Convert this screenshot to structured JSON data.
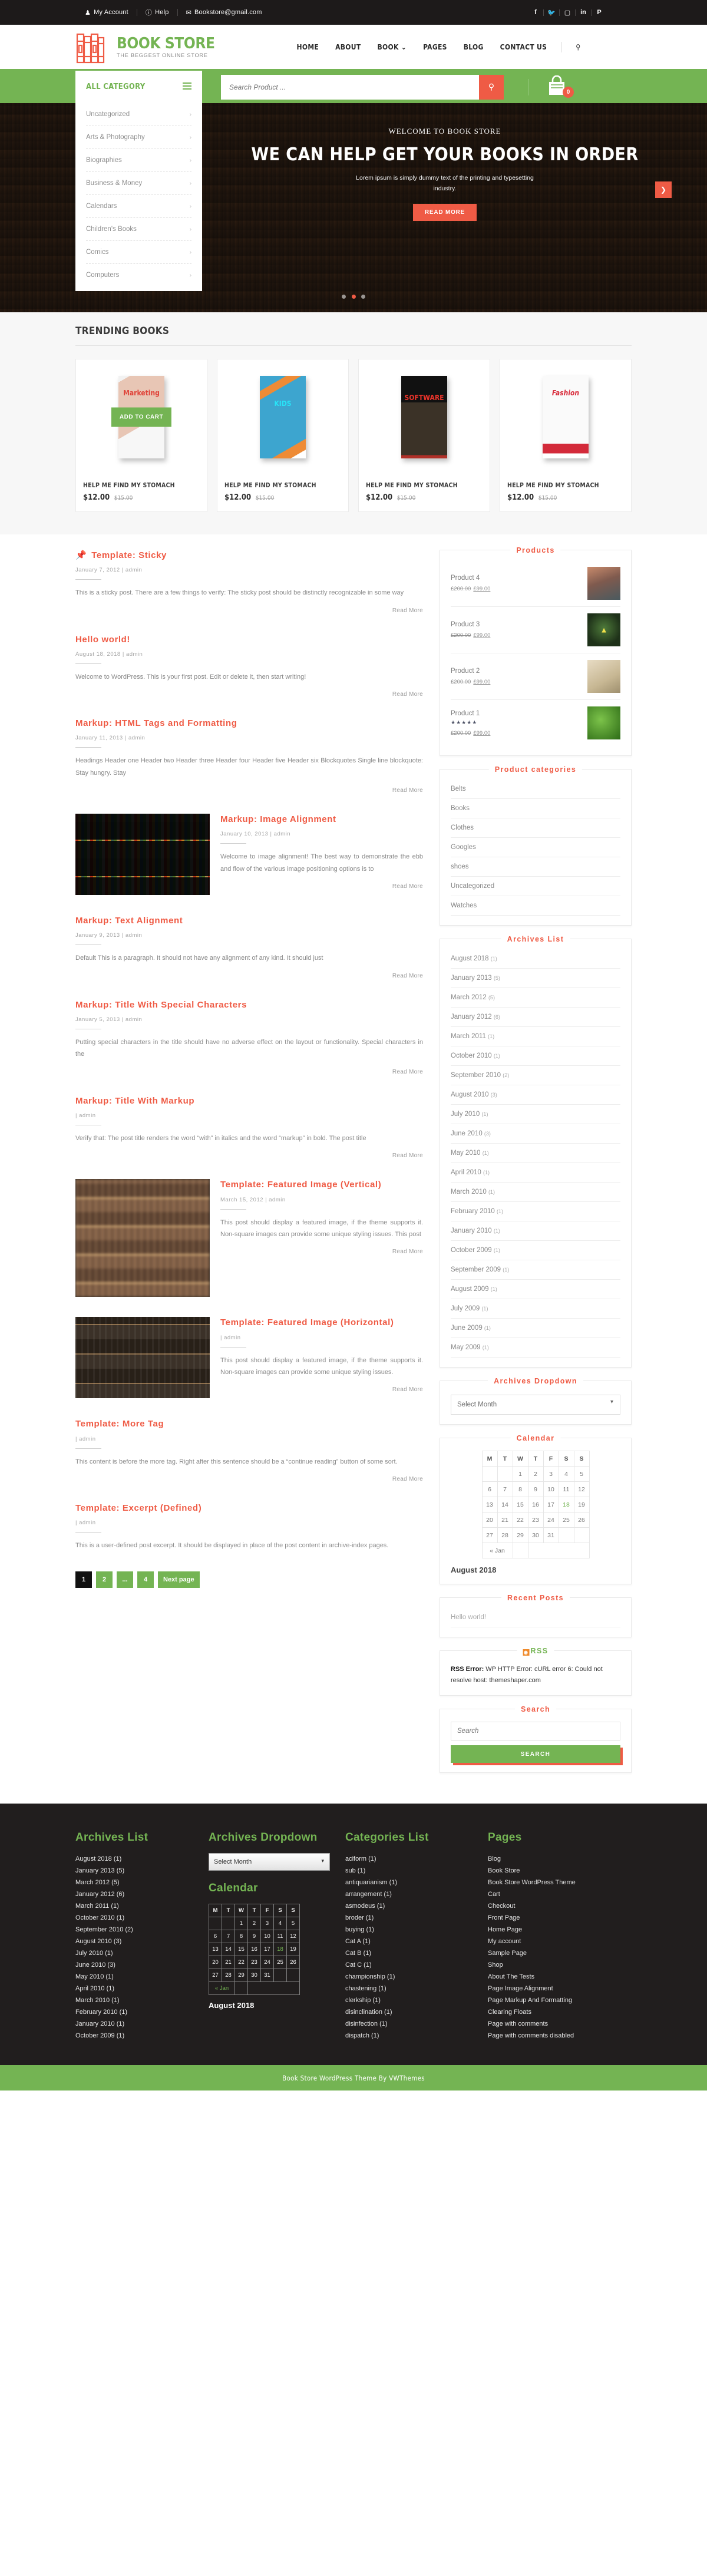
{
  "topbar": {
    "links": [
      {
        "icon": "user-icon",
        "label": "My Account"
      },
      {
        "icon": "help-icon",
        "label": "Help"
      },
      {
        "icon": "mail-icon",
        "label": "Bookstore@gmail.com"
      }
    ],
    "social": [
      "facebook-icon",
      "twitter-icon",
      "instagram-icon",
      "linkedin-icon",
      "pinterest-icon"
    ]
  },
  "header": {
    "logo_title": "BOOK STORE",
    "logo_sub": "THE BEGGEST ONLINE STORE",
    "nav": [
      {
        "label": "HOME"
      },
      {
        "label": "ABOUT"
      },
      {
        "label": "BOOK",
        "caret": "⌄"
      },
      {
        "label": "PAGES"
      },
      {
        "label": "BLOG"
      },
      {
        "label": "CONTACT US"
      }
    ]
  },
  "searchband": {
    "category_label": "ALL CATEGORY",
    "placeholder": "Search Product ...",
    "cart_count": "0"
  },
  "categories": [
    "Uncategorized",
    "Arts & Photography",
    "Biographies",
    "Business & Money",
    "Calendars",
    "Children's Books",
    "Comics",
    "Computers"
  ],
  "hero": {
    "eyebrow": "WELCOME TO BOOK STORE",
    "title": "WE CAN HELP GET YOUR BOOKS IN  ORDER",
    "desc": "Lorem ipsum is simply dummy text of the printing and typesetting industry.",
    "button": "READ MORE",
    "arrow": "❯"
  },
  "trending": {
    "title": "TRENDING BOOKS",
    "add_to_cart": "ADD TO CART",
    "items": [
      {
        "cover": "Marketing",
        "name": "HELP ME FIND MY  STOMACH",
        "price": "$12.00",
        "was": "$15.00"
      },
      {
        "cover": "KIDS",
        "name": "HELP ME FIND MY  STOMACH",
        "price": "$12.00",
        "was": "$15.00"
      },
      {
        "cover": "SOFTWARE",
        "name": "HELP ME FIND MY  STOMACH",
        "price": "$12.00",
        "was": "$15.00"
      },
      {
        "cover": "Fashion",
        "name": "HELP ME FIND MY  STOMACH",
        "price": "$12.00",
        "was": "$15.00"
      }
    ]
  },
  "read_more": "Read More",
  "posts": [
    {
      "title": "Template: Sticky",
      "sticky": true,
      "meta": "January 7, 2012 |  admin",
      "text": "This is a sticky post. There are a few things to verify: The sticky post should be distinctly recognizable in some way",
      "layout": "plain"
    },
    {
      "title": "Hello world!",
      "meta": "August 18, 2018 |  admin",
      "text": "Welcome to WordPress. This is your first post. Edit or delete it, then start writing!",
      "layout": "plain"
    },
    {
      "title": "Markup: HTML Tags and Formatting",
      "meta": "January 11, 2013 |  admin",
      "text": "Headings Header one Header two Header three Header four Header five Header six Blockquotes Single line blockquote: Stay hungry. Stay",
      "layout": "plain"
    },
    {
      "title": "Markup: Image Alignment",
      "meta": "January 10, 2013 |  admin",
      "text": "Welcome to image alignment! The best way to demonstrate the ebb and flow of the various image positioning options is to",
      "layout": "image-left",
      "thumb": "colorful"
    },
    {
      "title": "Markup: Text Alignment",
      "meta": "January 9, 2013 |  admin",
      "text": "Default This is a paragraph. It should not have any alignment of any kind. It should just",
      "layout": "plain"
    },
    {
      "title": "Markup: Title With Special Characters",
      "meta": "January 5, 2013 |  admin",
      "text": "Putting special characters in the title should have no adverse effect on the layout or functionality. Special characters in the",
      "layout": "plain"
    },
    {
      "title": "Markup: Title With Markup",
      "meta": "|  admin",
      "text": "Verify that: The post title renders the word “with” in italics and the word “markup” in bold. The post title",
      "layout": "plain"
    },
    {
      "title": "Template: Featured Image (Vertical)",
      "meta": "March 15, 2012 |  admin",
      "text": "This post should display a featured image, if the theme supports it. Non-square images can provide some unique styling issues. This post",
      "layout": "image-left-tall",
      "thumb": "warm"
    },
    {
      "title": "Template: Featured Image (Horizontal)",
      "meta": "|  admin",
      "text": "This post should display a featured image, if the theme supports it. Non-square images can provide some unique styling issues.",
      "layout": "image-left",
      "thumb": "dim"
    },
    {
      "title": "Template: More Tag",
      "meta": "|  admin",
      "text": "This content is before the more tag. Right after this sentence should be a “continue reading” button of some sort.",
      "layout": "plain"
    },
    {
      "title": "Template: Excerpt (Defined)",
      "meta": "|  admin",
      "text": "This is a user-defined post excerpt. It should be displayed in place of the post content in archive-index pages.",
      "layout": "plain"
    }
  ],
  "pagination": [
    {
      "label": "1",
      "current": true
    },
    {
      "label": "2",
      "current": false
    },
    {
      "label": "...",
      "current": false
    },
    {
      "label": "4",
      "current": false
    },
    {
      "label": "Next page",
      "current": false
    }
  ],
  "sidebar": {
    "products_title": "Products",
    "products": [
      {
        "name": "Product 4",
        "old": "£200.00",
        "new": "£99.00",
        "stars": "",
        "thumb": "coral"
      },
      {
        "name": "Product 3",
        "old": "£200.00",
        "new": "£99.00",
        "stars": "",
        "thumb": "green"
      },
      {
        "name": "Product 2",
        "old": "£200.00",
        "new": "£99.00",
        "stars": "",
        "thumb": "glass"
      },
      {
        "name": "Product 1",
        "old": "£200.00",
        "new": "£99.00",
        "stars": "★★★★★",
        "thumb": "leaf"
      }
    ],
    "product_categories_title": "Product categories",
    "product_categories": [
      "Belts",
      "Books",
      "Clothes",
      "Googles",
      "shoes",
      "Uncategorized",
      "Watches"
    ],
    "archives_title": "Archives List",
    "archives": [
      {
        "label": "August 2018",
        "count": "(1)"
      },
      {
        "label": "January 2013",
        "count": "(5)"
      },
      {
        "label": "March 2012",
        "count": "(5)"
      },
      {
        "label": "January 2012",
        "count": "(6)"
      },
      {
        "label": "March 2011",
        "count": "(1)"
      },
      {
        "label": "October 2010",
        "count": "(1)"
      },
      {
        "label": "September 2010",
        "count": "(2)"
      },
      {
        "label": "August 2010",
        "count": "(3)"
      },
      {
        "label": "July 2010",
        "count": "(1)"
      },
      {
        "label": "June 2010",
        "count": "(3)"
      },
      {
        "label": "May 2010",
        "count": "(1)"
      },
      {
        "label": "April 2010",
        "count": "(1)"
      },
      {
        "label": "March 2010",
        "count": "(1)"
      },
      {
        "label": "February 2010",
        "count": "(1)"
      },
      {
        "label": "January 2010",
        "count": "(1)"
      },
      {
        "label": "October 2009",
        "count": "(1)"
      },
      {
        "label": "September 2009",
        "count": "(1)"
      },
      {
        "label": "August 2009",
        "count": "(1)"
      },
      {
        "label": "July 2009",
        "count": "(1)"
      },
      {
        "label": "June 2009",
        "count": "(1)"
      },
      {
        "label": "May 2009",
        "count": "(1)"
      }
    ],
    "archives_dropdown_title": "Archives Dropdown",
    "select_month": "Select Month",
    "calendar_title": "Calendar",
    "recent_posts_title": "Recent Posts",
    "recent_posts": [
      "Hello world!"
    ],
    "rss_title": "RSS",
    "rss_error_label": "RSS Error:",
    "rss_error_text": " WP HTTP Error: cURL error 6: Could not resolve host: themeshaper.com",
    "search_title": "Search",
    "search_placeholder": "Search",
    "search_button": "SEARCH"
  },
  "calendar": {
    "caption": "August 2018",
    "dow": [
      "M",
      "T",
      "W",
      "T",
      "F",
      "S",
      "S"
    ],
    "weeks": [
      [
        "",
        "",
        "1",
        "2",
        "3",
        "4",
        "5"
      ],
      [
        "6",
        "7",
        "8",
        "9",
        "10",
        "11",
        "12"
      ],
      [
        "13",
        "14",
        "15",
        "16",
        "17",
        "18",
        "19"
      ],
      [
        "20",
        "21",
        "22",
        "23",
        "24",
        "25",
        "26"
      ],
      [
        "27",
        "28",
        "29",
        "30",
        "31",
        "",
        ""
      ]
    ],
    "today": "18",
    "prev_label": "« Jan"
  },
  "footer": {
    "archives_title": "Archives List",
    "archives_dropdown_title": "Archives Dropdown",
    "calendar_title": "Calendar",
    "categories_title": "Categories List",
    "pages_title": "Pages",
    "select_month": "Select Month",
    "categories": [
      {
        "label": "aciform",
        "count": "(1)"
      },
      {
        "label": "sub",
        "count": "(1)"
      },
      {
        "label": "antiquarianism",
        "count": "(1)"
      },
      {
        "label": "arrangement",
        "count": "(1)"
      },
      {
        "label": "asmodeus",
        "count": "(1)"
      },
      {
        "label": "broder",
        "count": "(1)"
      },
      {
        "label": "buying",
        "count": "(1)"
      },
      {
        "label": "Cat A",
        "count": "(1)"
      },
      {
        "label": "Cat B",
        "count": "(1)"
      },
      {
        "label": "Cat C",
        "count": "(1)"
      },
      {
        "label": "championship",
        "count": "(1)"
      },
      {
        "label": "chastening",
        "count": "(1)"
      },
      {
        "label": "clerkship",
        "count": "(1)"
      },
      {
        "label": "disinclination",
        "count": "(1)"
      },
      {
        "label": "disinfection",
        "count": "(1)"
      },
      {
        "label": "dispatch",
        "count": "(1)"
      }
    ],
    "pages": [
      "Blog",
      "Book Store",
      "Book Store WordPress Theme",
      "Cart",
      "Checkout",
      "Front Page",
      "Home Page",
      "My account",
      "Sample Page",
      "Shop",
      "About The Tests",
      "Page Image Alignment",
      "Page Markup And Formatting",
      "Clearing Floats",
      "Page with comments",
      "Page with comments disabled"
    ],
    "copyright": "Book Store WordPress Theme By VWThemes"
  },
  "colors": {
    "green": "#74b453",
    "orange": "#ef5b45",
    "dark": "#211e1e"
  }
}
